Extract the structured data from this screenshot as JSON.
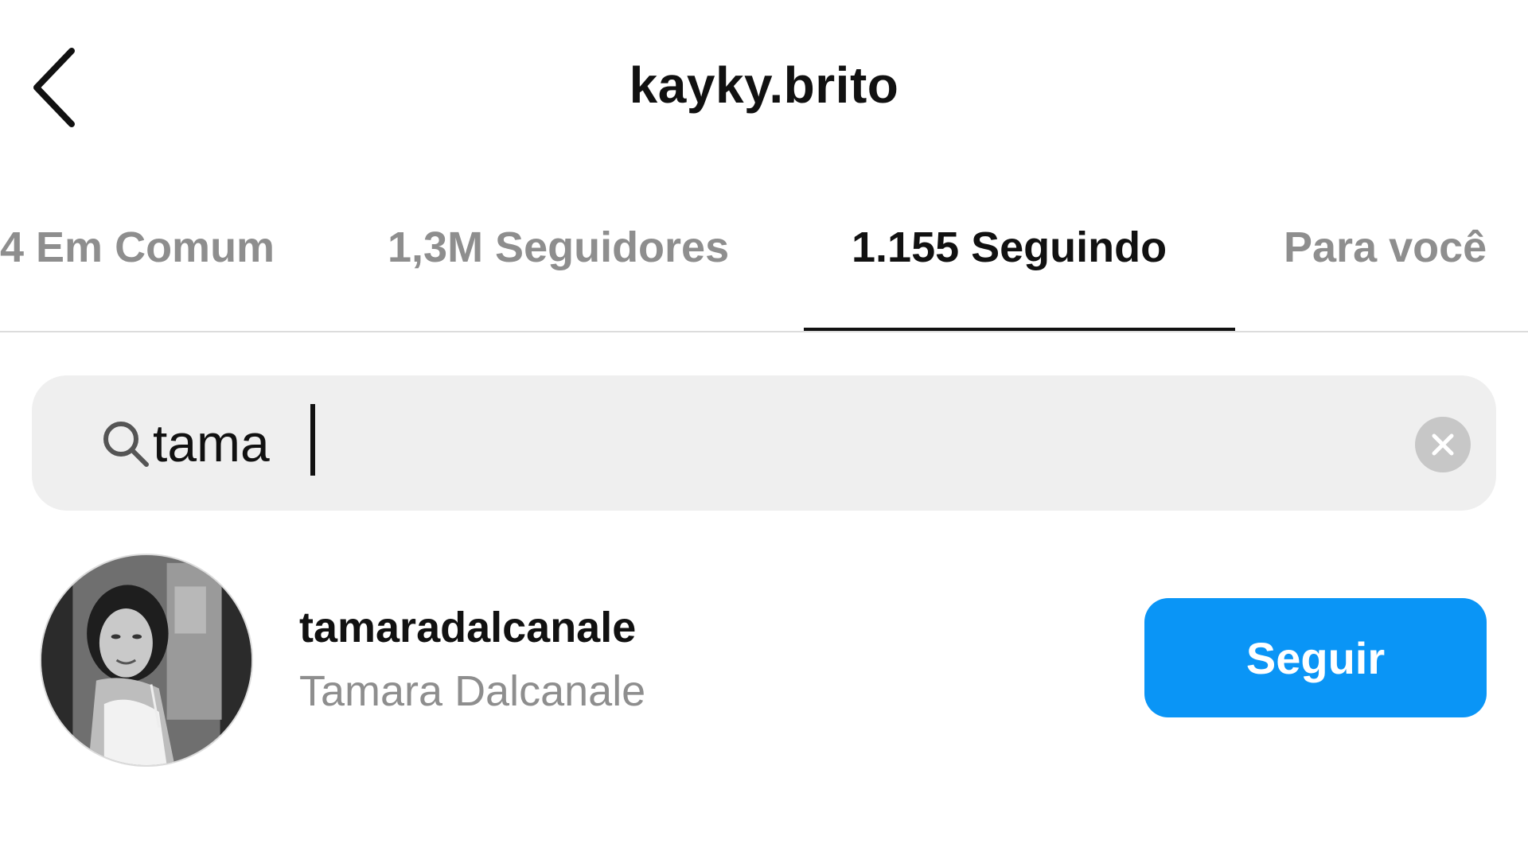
{
  "header": {
    "title": "kayky.brito",
    "back_icon": "chevron-left-icon"
  },
  "tabs": [
    {
      "label": "4 Em Comum",
      "active": false
    },
    {
      "label": "1,3M Seguidores",
      "active": false
    },
    {
      "label": "1.155 Seguindo",
      "active": true
    },
    {
      "label": "Para você",
      "active": false
    }
  ],
  "search": {
    "value": "tama",
    "icon": "search-icon",
    "clear_icon": "clear-icon"
  },
  "results": [
    {
      "username": "tamaradalcanale",
      "full_name": "Tamara Dalcanale",
      "avatar": "profile-photo",
      "action_label": "Seguir"
    }
  ],
  "colors": {
    "accent": "#0a95f6",
    "muted_text": "#8e8e8e",
    "search_bg": "#efefef"
  }
}
